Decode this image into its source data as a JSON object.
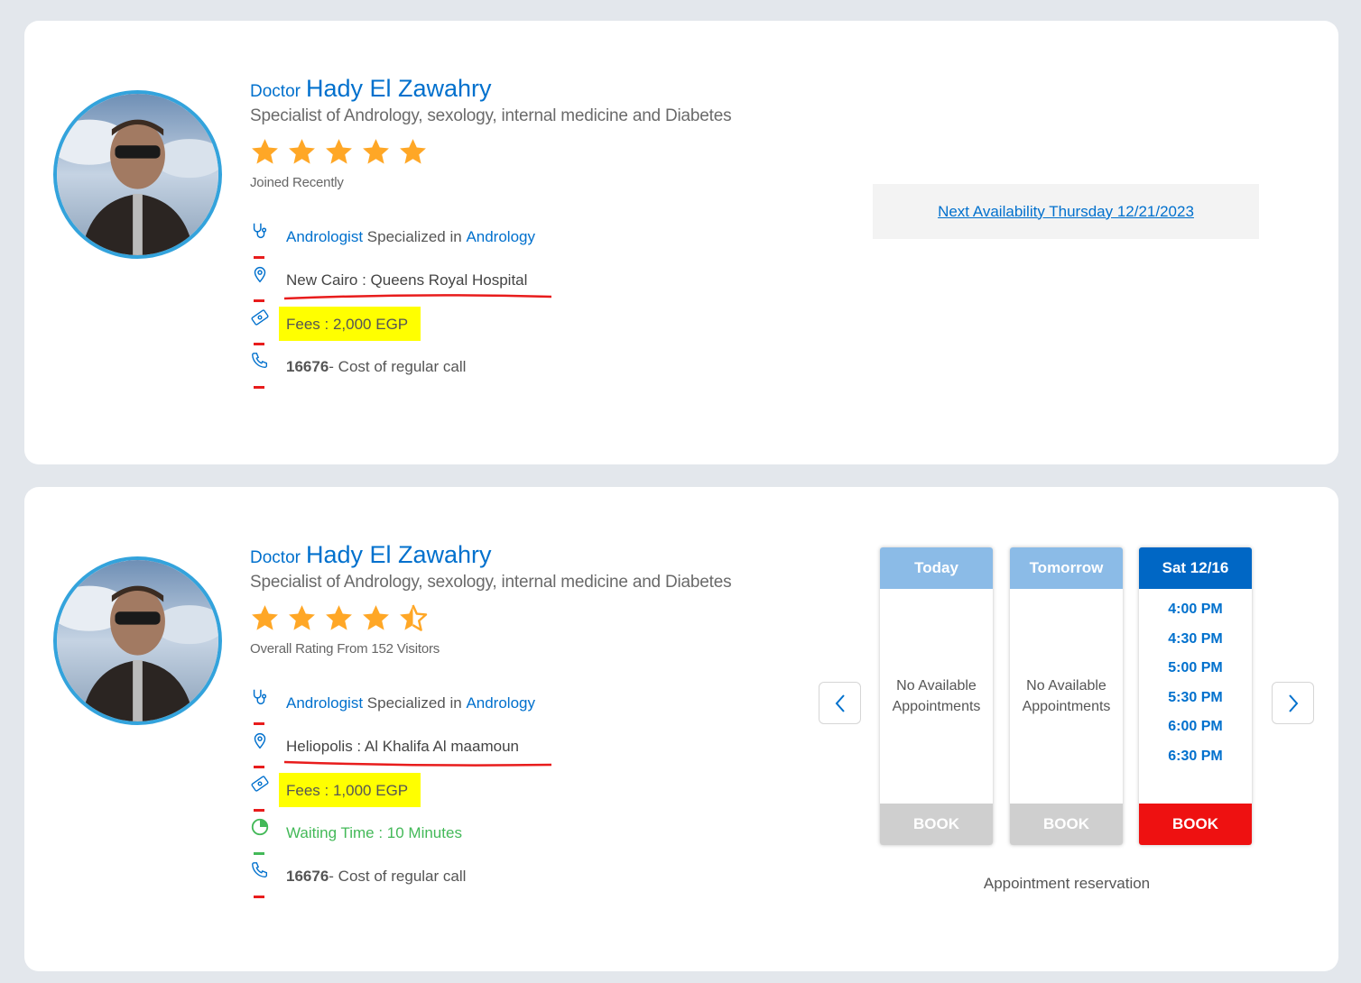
{
  "cards": [
    {
      "doctor_title": "Doctor",
      "doctor_name": "Hady El Zawahry",
      "specialty": "Specialist of Andrology, sexology, internal medicine and Diabetes",
      "rating_value": 5,
      "rating_text": "Joined Recently",
      "specialization": {
        "role": "Andrologist",
        "middle": "Specialized in",
        "field": "Andrology"
      },
      "location": "New Cairo : Queens Royal Hospital",
      "fees": "Fees : 2,000 EGP",
      "phone": {
        "number": "16676",
        "note": " - Cost of regular call"
      },
      "next_availability": "Next Availability Thursday 12/21/2023"
    },
    {
      "doctor_title": "Doctor",
      "doctor_name": "Hady El Zawahry",
      "specialty": "Specialist of Andrology, sexology, internal medicine and Diabetes",
      "rating_value": 4.5,
      "rating_text": "Overall Rating From 152 Visitors",
      "specialization": {
        "role": "Andrologist",
        "middle": "Specialized in",
        "field": "Andrology"
      },
      "location": "Heliopolis : Al Khalifa Al maamoun",
      "fees": "Fees : 1,000 EGP",
      "waiting_time": "Waiting Time : 10 Minutes",
      "phone": {
        "number": "16676",
        "note": " - Cost of regular call"
      },
      "schedule": {
        "columns": [
          {
            "header": "Today",
            "empty_line1": "No Available",
            "empty_line2": "Appointments",
            "book": "BOOK"
          },
          {
            "header": "Tomorrow",
            "empty_line1": "No Available",
            "empty_line2": "Appointments",
            "book": "BOOK"
          },
          {
            "header": "Sat 12/16",
            "times": [
              "4:00 PM",
              "4:30 PM",
              "5:00 PM",
              "5:30 PM",
              "6:00 PM",
              "6:30 PM"
            ],
            "book": "BOOK"
          }
        ],
        "footer": "Appointment reservation"
      }
    }
  ],
  "icons": {
    "specialty": "stethoscope-icon",
    "location": "location-pin-icon",
    "fees": "money-tag-icon",
    "waiting": "clock-icon",
    "phone": "phone-icon",
    "prev": "chevron-left-icon",
    "next": "chevron-right-icon"
  },
  "colors": {
    "brand_blue": "#0070cd",
    "star": "#ffa726",
    "fees_highlight": "#ffff00",
    "book_active": "#ee1111",
    "book_disabled": "#cfcfcf",
    "waiting_green": "#43b958",
    "annotation_red": "#e81c1c"
  }
}
